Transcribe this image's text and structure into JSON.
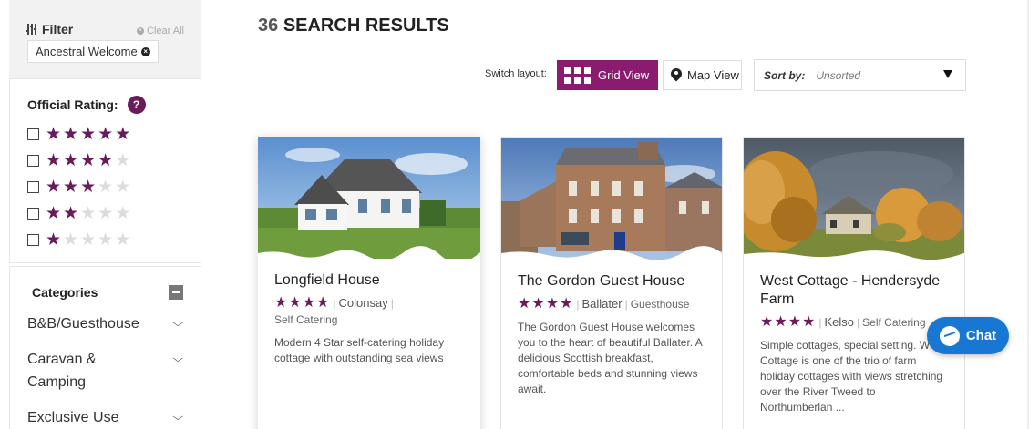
{
  "filter": {
    "title": "Filter",
    "clear_label": "Clear All",
    "active_tag": "Ancestral Welcome"
  },
  "rating": {
    "title": "Official Rating:",
    "help": "?",
    "options": [
      {
        "stars": 5
      },
      {
        "stars": 4
      },
      {
        "stars": 3
      },
      {
        "stars": 2
      },
      {
        "stars": 1
      }
    ],
    "accent_color": "#6b1a5a"
  },
  "categories": {
    "title": "Categories",
    "items": [
      {
        "label": "B&B/Guesthouse"
      },
      {
        "label": "Caravan & Camping"
      },
      {
        "label": "Exclusive Use"
      }
    ]
  },
  "results": {
    "count": "36",
    "label": "SEARCH RESULTS"
  },
  "layout_switch": {
    "label": "Switch layout:",
    "grid_label": "Grid View",
    "map_label": "Map View",
    "active_color": "#8a1b6e"
  },
  "sort": {
    "label": "Sort by:",
    "value": "Unsorted"
  },
  "cards": [
    {
      "title": "Longfield House",
      "stars": "★★★★",
      "location": "Colonsay",
      "type": "Self Catering",
      "description": "Modern 4 Star self-catering holiday cottage with outstanding sea views"
    },
    {
      "title": "The Gordon Guest House",
      "stars": "★★★★",
      "location": "Ballater",
      "type": "Guesthouse",
      "description": "The Gordon Guest House welcomes you to the heart of beautiful Ballater. A delicious Scottish breakfast, comfortable beds and stunning views await."
    },
    {
      "title": "West Cottage - Hendersyde Farm",
      "stars": "★★★★",
      "location": "Kelso",
      "type": "Self Catering",
      "description": "Simple cottages, special setting. W Cottage is one of the trio of farm holiday cottages with views stretching over the River Tweed to Northumberlan ..."
    }
  ],
  "chat": {
    "label": "Chat",
    "color": "#1877d2"
  }
}
